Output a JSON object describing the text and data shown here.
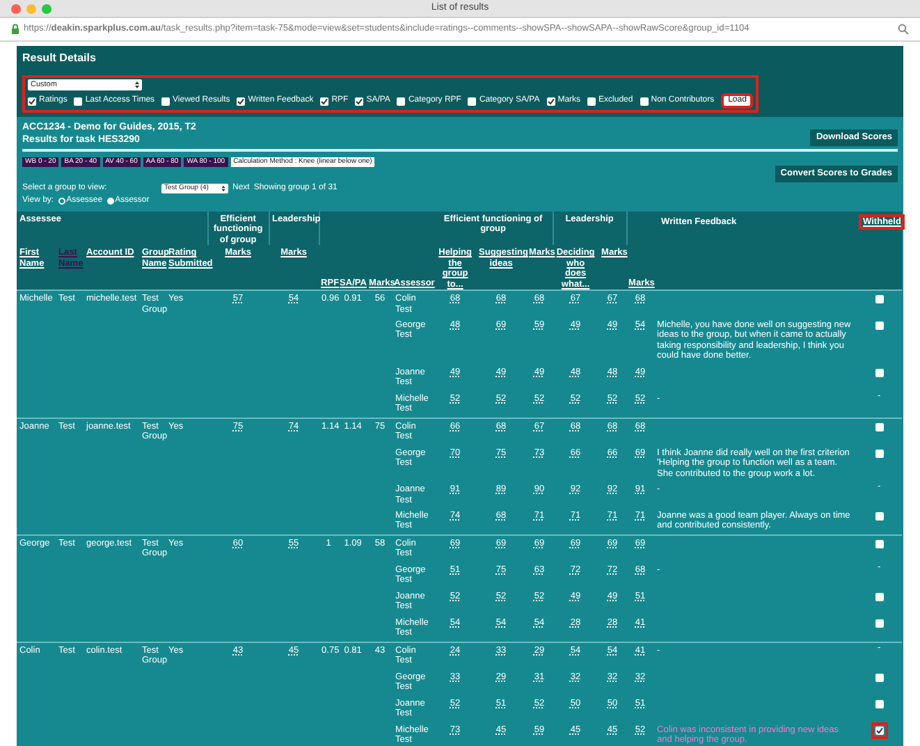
{
  "window": {
    "title": "List of results"
  },
  "address_bar": {
    "url": "https://**deakin.sparkplus.com.au**/task_results.php?item=task-75&mode=view&set=students&include=ratings--comments--showSPA--showSAPA--showRawScore&group_id=1104"
  },
  "page_title": "Result Details",
  "display_options": {
    "highlighted": true,
    "preset": "Custom",
    "options": [
      {
        "label": "Ratings",
        "checked": true
      },
      {
        "label": "Last Access Times",
        "checked": false
      },
      {
        "label": "Viewed Results",
        "checked": false
      },
      {
        "label": "Written Feedback",
        "checked": true
      },
      {
        "label": "RPF",
        "checked": true
      },
      {
        "label": "SA/PA",
        "checked": true
      },
      {
        "label": "Category RPF",
        "checked": false
      },
      {
        "label": "Category SA/PA",
        "checked": false
      },
      {
        "label": "Marks",
        "checked": true
      },
      {
        "label": "Excluded",
        "checked": false
      },
      {
        "label": "Non Contributors",
        "checked": false
      }
    ],
    "load_button": {
      "label": "Load",
      "highlighted": true
    }
  },
  "course": "ACC1234 - Demo for Guides, 2015, T2",
  "task": "Results for task HES3290",
  "download_button": "Download Scores",
  "legend": [
    {
      "kind": "band",
      "label": "WB 0 - 20"
    },
    {
      "kind": "band",
      "label": "BA 20 - 40"
    },
    {
      "kind": "band",
      "label": "AV 40 - 60"
    },
    {
      "kind": "band",
      "label": "AA 60 - 80"
    },
    {
      "kind": "band",
      "label": "WA 80 - 100"
    },
    {
      "kind": "method",
      "label": "Calculation Method : Knee (linear below one)"
    }
  ],
  "convert_button": "Convert Scores to Grades",
  "group_select": {
    "label": "Select a group to view:",
    "value": "Test Group (4)",
    "next": "Next",
    "status": "Showing group 1 of 31"
  },
  "view_by": {
    "label": "View by:",
    "options": [
      {
        "label": "Assessee",
        "selected": false
      },
      {
        "label": "Assessor",
        "selected": true
      }
    ]
  },
  "header_groups": [
    {
      "label": "Assessee",
      "columns": [
        {
          "label": "First Name",
          "sorted": false
        },
        {
          "label": "Last Name",
          "sorted": true
        },
        {
          "label": "Account ID",
          "sorted": false
        },
        {
          "label": "Group Name",
          "sorted": false
        },
        {
          "label": "Rating Submitted",
          "sorted": false
        }
      ]
    },
    {
      "label": "Efficient functioning of group",
      "columns": [
        {
          "label": "Marks",
          "sorted": false
        }
      ]
    },
    {
      "label": "Leadership",
      "columns": [
        {
          "label": "Marks",
          "sorted": false
        }
      ]
    },
    {
      "columns": [
        {
          "label": "RPF",
          "sorted": false
        },
        {
          "label": "SA/PA",
          "sorted": false
        },
        {
          "label": "Marks",
          "sorted": false
        },
        {
          "label": "Assessor",
          "sorted": false
        }
      ]
    },
    {
      "label": "Efficient functioning of group",
      "columns": [
        {
          "label": "Helping the group to...",
          "sorted": false
        },
        {
          "label": "Suggesting ideas",
          "sorted": false
        },
        {
          "label": "Marks",
          "sorted": false
        }
      ]
    },
    {
      "label": "Leadership",
      "columns": [
        {
          "label": "Deciding who does what...",
          "sorted": false
        },
        {
          "label": "Marks",
          "sorted": false
        }
      ]
    },
    {
      "columns": [
        {
          "label": "Marks",
          "sorted": false
        }
      ]
    },
    {
      "label": "Written Feedback",
      "highlighted": false
    },
    {
      "label": "Withheld",
      "highlighted": true
    }
  ],
  "assessees": [
    {
      "first_name": "Michelle",
      "last_name": "Test",
      "account_id": "michelle.test",
      "group_name": "Test Group",
      "rating_submitted": "Yes",
      "eff_marks": "57",
      "lead_marks": "54",
      "rpf": "0.96",
      "sapa": "0.91",
      "marks": "56",
      "assessors": [
        {
          "name": "Colin Test",
          "scores": [
            "68",
            "68",
            "68",
            "67",
            "67",
            "68"
          ],
          "withheld": false
        },
        {
          "name": "George Test",
          "scores": [
            "48",
            "69",
            "59",
            "49",
            "49",
            "54"
          ],
          "feedback": "Michelle, you have done well on suggesting new ideas to the group, but when it came to actually taking responsibility and leadership, I think you could have done better.",
          "withheld": false
        },
        {
          "name": "Joanne Test",
          "scores": [
            "49",
            "49",
            "49",
            "48",
            "48",
            "49"
          ],
          "withheld": false
        },
        {
          "name": "Michelle Test",
          "scores": [
            "52",
            "52",
            "52",
            "52",
            "52",
            "52"
          ],
          "feedback": "-",
          "withheld_text": "-"
        }
      ]
    },
    {
      "first_name": "Joanne",
      "last_name": "Test",
      "account_id": "joanne.test",
      "group_name": "Test Group",
      "rating_submitted": "Yes",
      "eff_marks": "75",
      "lead_marks": "74",
      "rpf": "1.14",
      "sapa": "1.14",
      "marks": "75",
      "assessors": [
        {
          "name": "Colin Test",
          "scores": [
            "66",
            "68",
            "67",
            "68",
            "68",
            "68"
          ],
          "withheld": false
        },
        {
          "name": "George Test",
          "scores": [
            "70",
            "75",
            "73",
            "66",
            "66",
            "69"
          ],
          "feedback": "I think Joanne did really well on the first criterion 'Helping the group to function well as a team. She contributed to the group work a lot.",
          "withheld": false
        },
        {
          "name": "Joanne Test",
          "scores": [
            "91",
            "89",
            "90",
            "92",
            "92",
            "91"
          ],
          "feedback": "-",
          "withheld_text": "-"
        },
        {
          "name": "Michelle Test",
          "scores": [
            "74",
            "68",
            "71",
            "71",
            "71",
            "71"
          ],
          "feedback": "Joanne was a good team player. Always on time and contributed consistently.",
          "withheld": false
        }
      ]
    },
    {
      "first_name": "George",
      "last_name": "Test",
      "account_id": "george.test",
      "group_name": "Test Group",
      "rating_submitted": "Yes",
      "eff_marks": "60",
      "lead_marks": "55",
      "rpf": "1",
      "sapa": "1.09",
      "marks": "58",
      "assessors": [
        {
          "name": "Colin Test",
          "scores": [
            "69",
            "69",
            "69",
            "69",
            "69",
            "69"
          ],
          "withheld": false
        },
        {
          "name": "George Test",
          "scores": [
            "51",
            "75",
            "63",
            "72",
            "72",
            "68"
          ],
          "feedback": "-",
          "withheld_text": "-"
        },
        {
          "name": "Joanne Test",
          "scores": [
            "52",
            "52",
            "52",
            "49",
            "49",
            "51"
          ],
          "withheld": false
        },
        {
          "name": "Michelle Test",
          "scores": [
            "54",
            "54",
            "54",
            "28",
            "28",
            "41"
          ],
          "withheld": false
        }
      ]
    },
    {
      "first_name": "Colin",
      "last_name": "Test",
      "account_id": "colin.test",
      "group_name": "Test Group",
      "rating_submitted": "Yes",
      "eff_marks": "43",
      "lead_marks": "45",
      "rpf": "0.75",
      "sapa": "0.81",
      "marks": "43",
      "assessors": [
        {
          "name": "Colin Test",
          "scores": [
            "24",
            "33",
            "29",
            "54",
            "54",
            "41"
          ],
          "feedback": "-",
          "withheld_text": "-"
        },
        {
          "name": "George Test",
          "scores": [
            "33",
            "29",
            "31",
            "32",
            "32",
            "32"
          ],
          "withheld": false
        },
        {
          "name": "Joanne Test",
          "scores": [
            "52",
            "51",
            "52",
            "50",
            "50",
            "51"
          ],
          "withheld": false
        },
        {
          "name": "Michelle Test",
          "scores": [
            "73",
            "45",
            "59",
            "45",
            "45",
            "52"
          ],
          "feedback": "Colin was inconsistent in providing new ideas and helping the group.",
          "withheld": true
        }
      ]
    }
  ]
}
